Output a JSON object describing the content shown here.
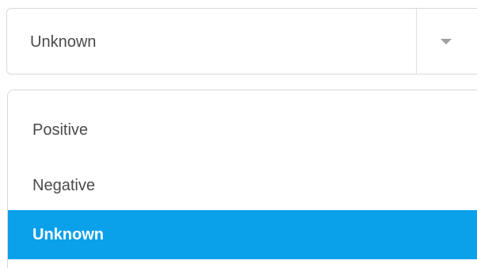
{
  "select": {
    "value": "Unknown",
    "icon": "caret-down-icon"
  },
  "menu": {
    "items": [
      {
        "label": "Positive"
      },
      {
        "label": "Negative"
      },
      {
        "label": "Unknown",
        "selected": true
      }
    ]
  },
  "colors": {
    "selected_background": "#0aa0ea",
    "selected_text": "#ffffff",
    "text": "#4a4a4a",
    "border": "#d9d9d9",
    "icon": "#9e9e9e"
  }
}
